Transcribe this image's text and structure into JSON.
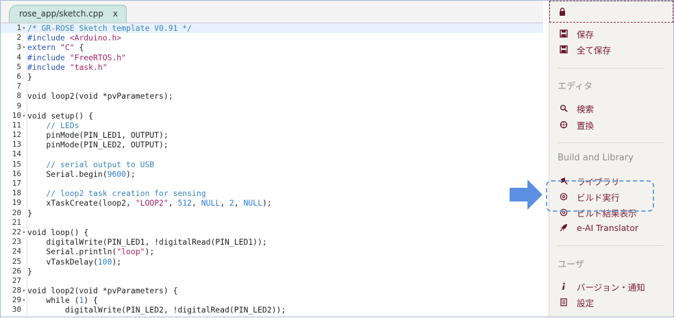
{
  "editor": {
    "tab_label": "rose_app/sketch.cpp",
    "tab_close": "x",
    "active_line": 1,
    "lines": [
      {
        "n": "1",
        "fold": true,
        "tokens": [
          [
            "c",
            "/* GR-ROSE Sketch template V0.91 */"
          ]
        ]
      },
      {
        "n": "2",
        "fold": false,
        "tokens": [
          [
            "k",
            "#include "
          ],
          [
            "s",
            "<Arduino.h>"
          ]
        ]
      },
      {
        "n": "3",
        "fold": true,
        "tokens": [
          [
            "k",
            "extern "
          ],
          [
            "s",
            "\"C\""
          ],
          [
            "p",
            " {"
          ]
        ]
      },
      {
        "n": "4",
        "fold": false,
        "tokens": [
          [
            "k",
            "#include "
          ],
          [
            "s",
            "\"FreeRTOS.h\""
          ]
        ]
      },
      {
        "n": "5",
        "fold": false,
        "tokens": [
          [
            "k",
            "#include "
          ],
          [
            "s",
            "\"task.h\""
          ]
        ]
      },
      {
        "n": "6",
        "fold": false,
        "tokens": [
          [
            "p",
            "}"
          ]
        ]
      },
      {
        "n": "7",
        "fold": false,
        "tokens": []
      },
      {
        "n": "8",
        "fold": false,
        "tokens": [
          [
            "p",
            "void loop2(void *pvParameters);"
          ]
        ]
      },
      {
        "n": "9",
        "fold": false,
        "tokens": []
      },
      {
        "n": "10",
        "fold": true,
        "tokens": [
          [
            "p",
            "void setup() {"
          ]
        ]
      },
      {
        "n": "11",
        "fold": false,
        "tokens": [
          [
            "p",
            "    "
          ],
          [
            "c",
            "// LEDs"
          ]
        ]
      },
      {
        "n": "12",
        "fold": false,
        "tokens": [
          [
            "p",
            "    pinMode(PIN_LED1, OUTPUT);"
          ]
        ]
      },
      {
        "n": "13",
        "fold": false,
        "tokens": [
          [
            "p",
            "    pinMode(PIN_LED2, OUTPUT);"
          ]
        ]
      },
      {
        "n": "14",
        "fold": false,
        "tokens": []
      },
      {
        "n": "15",
        "fold": false,
        "tokens": [
          [
            "p",
            "    "
          ],
          [
            "c",
            "// serial output to USB"
          ]
        ]
      },
      {
        "n": "16",
        "fold": false,
        "tokens": [
          [
            "p",
            "    Serial.begin("
          ],
          [
            "n",
            "9600"
          ],
          [
            "p",
            ");"
          ]
        ]
      },
      {
        "n": "17",
        "fold": false,
        "tokens": []
      },
      {
        "n": "18",
        "fold": false,
        "tokens": [
          [
            "p",
            "    "
          ],
          [
            "c",
            "// loop2 task creation for sensing"
          ]
        ]
      },
      {
        "n": "19",
        "fold": false,
        "tokens": [
          [
            "p",
            "    xTaskCreate(loop2, "
          ],
          [
            "s",
            "\"LOOP2\""
          ],
          [
            "p",
            ", "
          ],
          [
            "n",
            "512"
          ],
          [
            "p",
            ", "
          ],
          [
            "n",
            "NULL"
          ],
          [
            "p",
            ", "
          ],
          [
            "n",
            "2"
          ],
          [
            "p",
            ", "
          ],
          [
            "n",
            "NULL"
          ],
          [
            "p",
            ");"
          ]
        ]
      },
      {
        "n": "20",
        "fold": false,
        "tokens": [
          [
            "p",
            "}"
          ]
        ]
      },
      {
        "n": "21",
        "fold": false,
        "tokens": []
      },
      {
        "n": "22",
        "fold": true,
        "tokens": [
          [
            "p",
            "void loop() {"
          ]
        ]
      },
      {
        "n": "23",
        "fold": false,
        "tokens": [
          [
            "p",
            "    digitalWrite(PIN_LED1, !digitalRead(PIN_LED1));"
          ]
        ]
      },
      {
        "n": "24",
        "fold": false,
        "tokens": [
          [
            "p",
            "    Serial.println("
          ],
          [
            "s",
            "\"loop\""
          ],
          [
            "p",
            ");"
          ]
        ]
      },
      {
        "n": "25",
        "fold": false,
        "tokens": [
          [
            "p",
            "    vTaskDelay("
          ],
          [
            "n",
            "100"
          ],
          [
            "p",
            ");"
          ]
        ]
      },
      {
        "n": "26",
        "fold": false,
        "tokens": [
          [
            "p",
            "}"
          ]
        ]
      },
      {
        "n": "27",
        "fold": false,
        "tokens": []
      },
      {
        "n": "28",
        "fold": true,
        "tokens": [
          [
            "p",
            "void loop2(void *pvParameters) {"
          ]
        ]
      },
      {
        "n": "29",
        "fold": true,
        "tokens": [
          [
            "p",
            "    while ("
          ],
          [
            "n",
            "1"
          ],
          [
            "p",
            ") {"
          ]
        ]
      },
      {
        "n": "30",
        "fold": false,
        "tokens": [
          [
            "p",
            "        digitalWrite(PIN_LED2, !digitalRead(PIN_LED2));"
          ]
        ]
      }
    ]
  },
  "panel": {
    "lock_icon": "lock-icon",
    "items_file": [
      {
        "label": "保存",
        "icon": "save-icon",
        "name": "save"
      },
      {
        "label": "全て保存",
        "icon": "save-all-icon",
        "name": "save-all"
      }
    ],
    "section_editor": "エディタ",
    "items_editor": [
      {
        "label": "検索",
        "icon": "search-icon",
        "name": "search"
      },
      {
        "label": "置換",
        "icon": "replace-icon",
        "name": "replace"
      }
    ],
    "section_build": "Build and Library",
    "items_build": [
      {
        "label": "ライブラリ",
        "icon": "library-icon",
        "name": "library"
      },
      {
        "label": "ビルド実行",
        "icon": "build-run-icon",
        "name": "build-run"
      },
      {
        "label": "ビルド結果表示",
        "icon": "build-result-icon",
        "name": "build-result"
      },
      {
        "label": "e-AI Translator",
        "icon": "rocket-icon",
        "name": "e-ai-translator"
      }
    ],
    "section_user": "ユーザ",
    "items_user": [
      {
        "label": "バージョン・通知",
        "icon": "info-icon",
        "name": "version-notice"
      },
      {
        "label": "設定",
        "icon": "settings-icon",
        "name": "settings"
      }
    ]
  },
  "colors": {
    "accent": "#7a1a35",
    "highlight": "#6d9edc",
    "arrow": "#5b8fe0"
  }
}
